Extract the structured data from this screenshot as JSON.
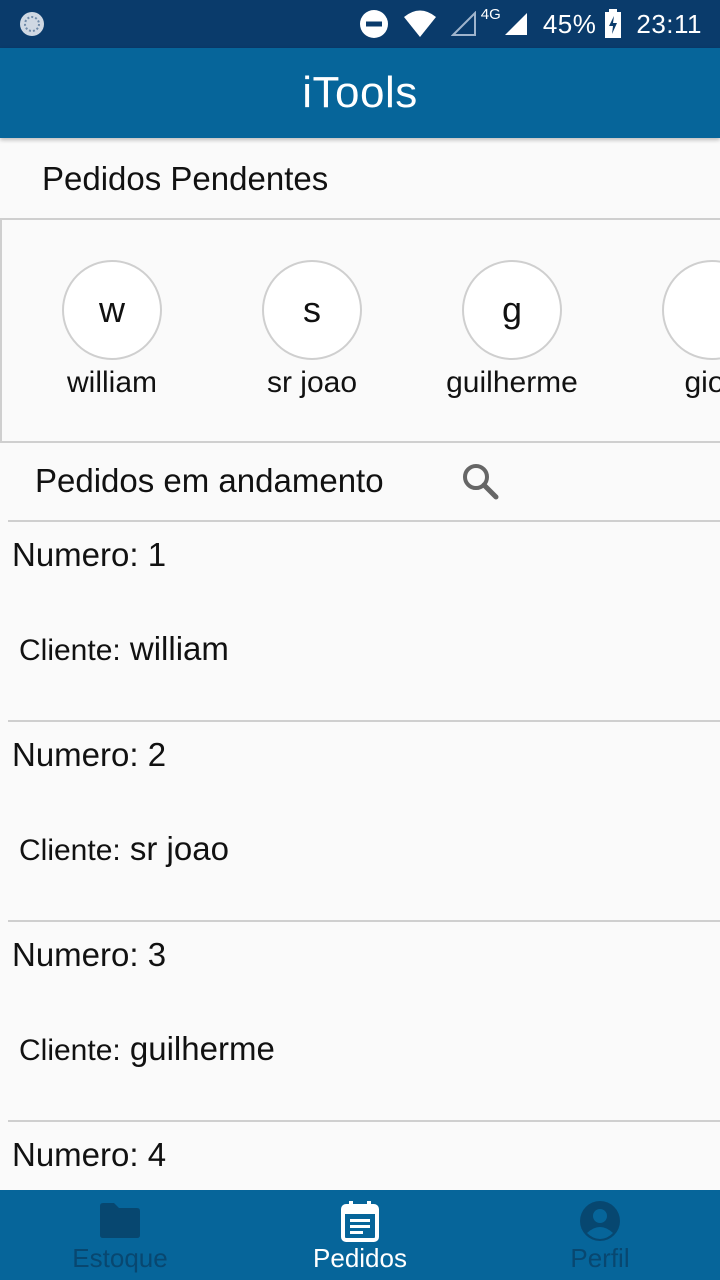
{
  "status_bar": {
    "network": "4G",
    "battery": "45%",
    "time": "23:11",
    "icons": [
      "app-notification-icon",
      "do-not-disturb-icon",
      "wifi-icon",
      "signal-empty-icon",
      "signal-icon",
      "battery-charging-icon"
    ]
  },
  "app_bar": {
    "title": "iTools"
  },
  "pending": {
    "title": "Pedidos Pendentes",
    "items": [
      {
        "initial": "w",
        "name": "william"
      },
      {
        "initial": "s",
        "name": "sr joao"
      },
      {
        "initial": "g",
        "name": "guilherme"
      },
      {
        "initial": "",
        "name": "giov"
      }
    ]
  },
  "in_progress": {
    "title": "Pedidos em andamento",
    "search_icon": "search-icon",
    "number_label": "Numero:",
    "client_label": "Cliente:",
    "orders": [
      {
        "number": "1",
        "client": "william"
      },
      {
        "number": "2",
        "client": "sr joao"
      },
      {
        "number": "3",
        "client": "guilherme"
      },
      {
        "number": "4",
        "client": ""
      }
    ]
  },
  "bottom_nav": {
    "items": [
      {
        "label": "Estoque",
        "icon": "folder-icon",
        "active": false
      },
      {
        "label": "Pedidos",
        "icon": "calendar-icon",
        "active": true
      },
      {
        "label": "Perfil",
        "icon": "account-icon",
        "active": false
      }
    ]
  },
  "colors": {
    "status_bar": "#0a3b6b",
    "primary": "#06659a",
    "background": "#fafafa",
    "divider": "#cfcfcf"
  }
}
